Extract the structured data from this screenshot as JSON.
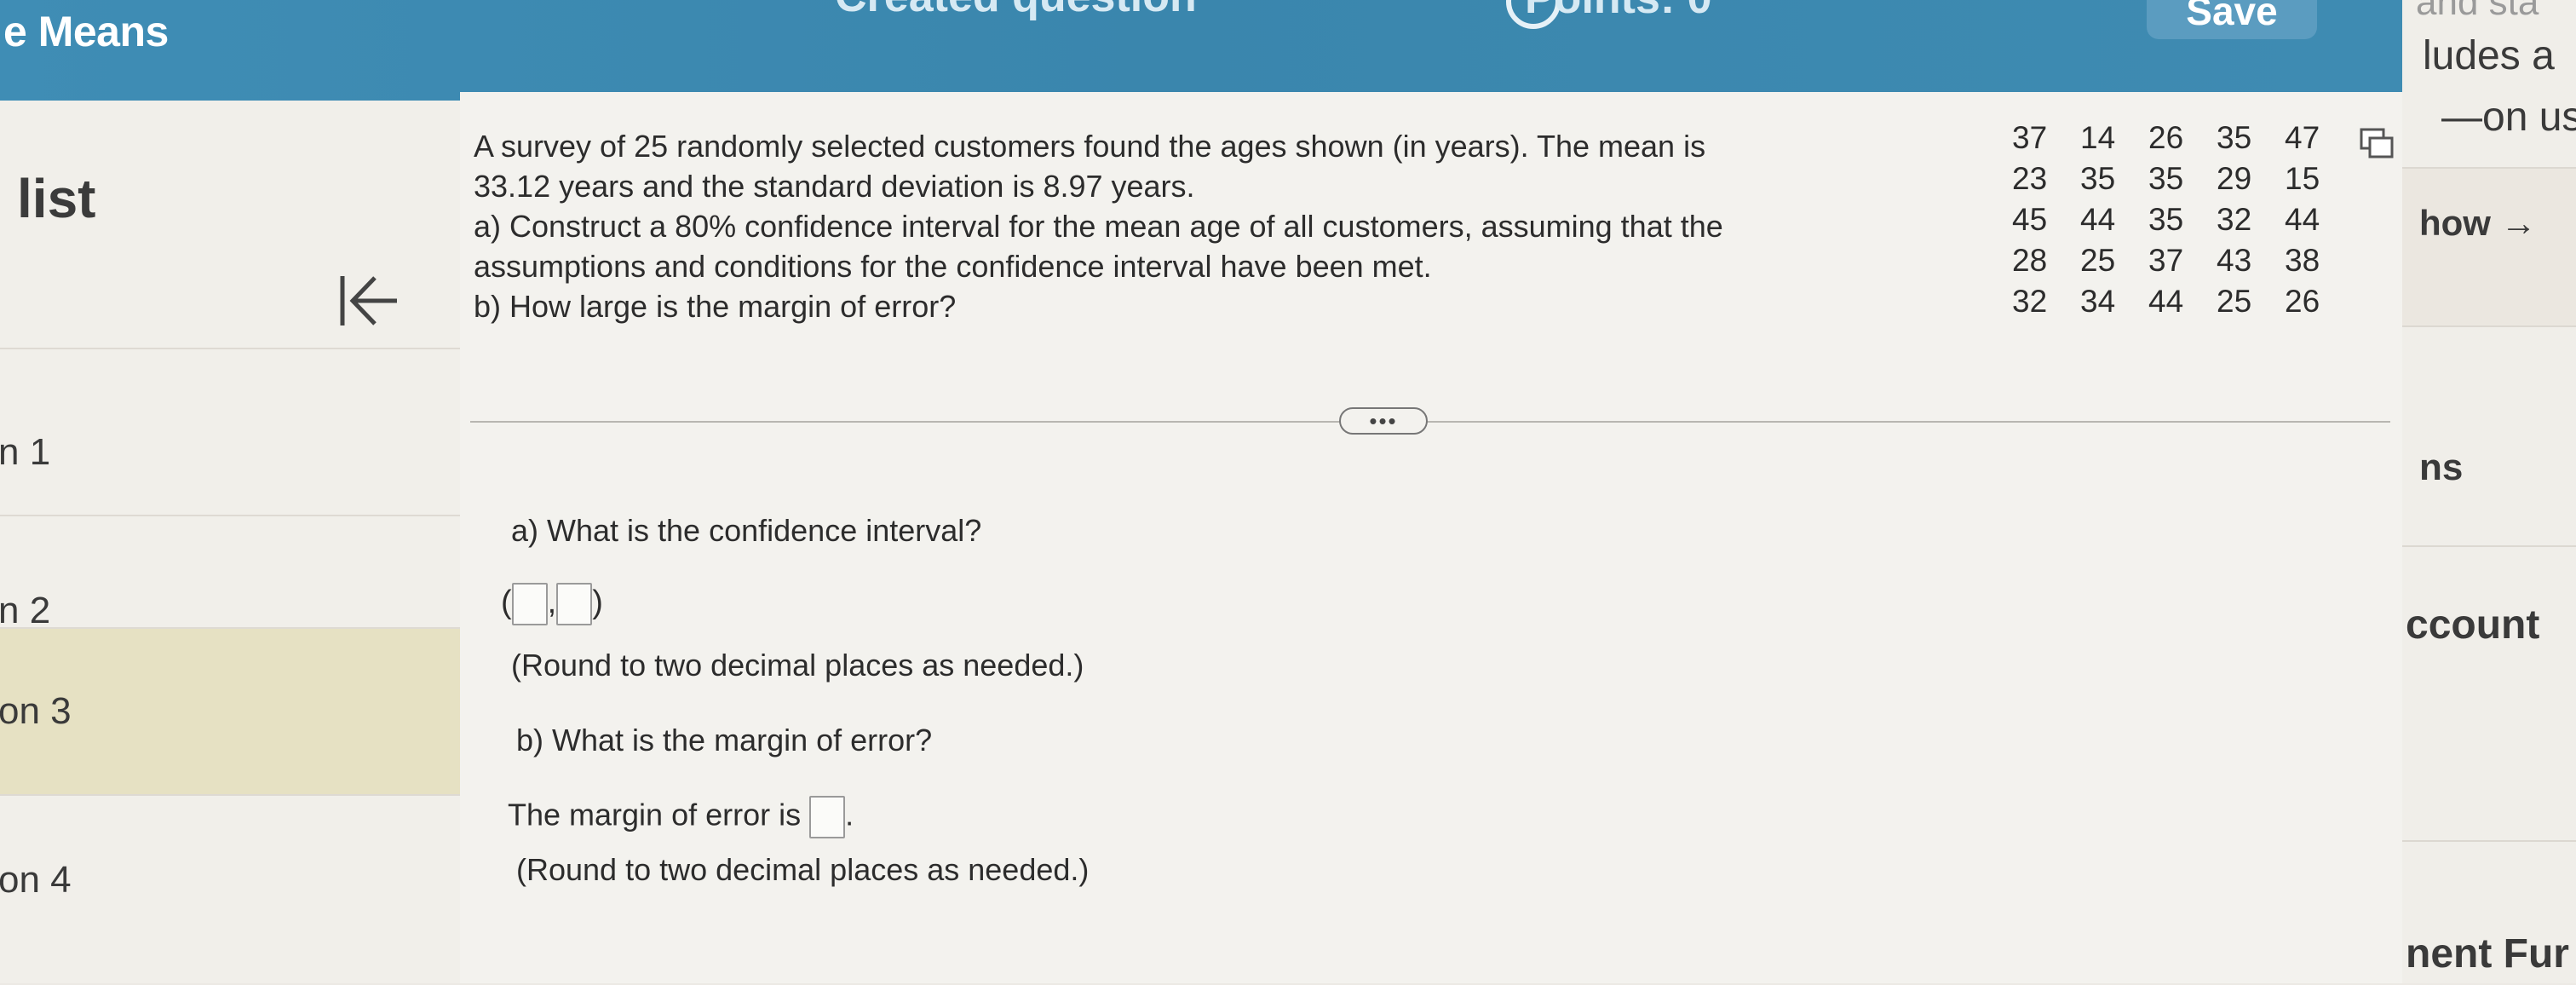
{
  "header": {
    "title": "e Means",
    "cut_text_1": "Created question",
    "cut_text_2": "Points: 0",
    "save_label": "Save"
  },
  "sidebar": {
    "title": "list",
    "items": [
      {
        "label": "n 1"
      },
      {
        "label": "n 2"
      },
      {
        "label": "on 3",
        "active": true
      },
      {
        "label": "on 4"
      }
    ]
  },
  "question": {
    "text_lines": [
      "A survey of 25 randomly selected customers found the ages shown (in years). The mean is",
      "33.12 years and the standard deviation is 8.97 years.",
      "a) Construct a 80% confidence interval for the mean age of all customers, assuming that the",
      "assumptions and conditions for the confidence interval have been met.",
      "b) How large is the margin of error?"
    ],
    "data_rows": [
      [
        "37",
        "14",
        "26",
        "35",
        "47"
      ],
      [
        "23",
        "35",
        "35",
        "29",
        "15"
      ],
      [
        "45",
        "44",
        "35",
        "32",
        "44"
      ],
      [
        "28",
        "25",
        "37",
        "43",
        "38"
      ],
      [
        "32",
        "34",
        "44",
        "25",
        "26"
      ]
    ],
    "more_label": "•••"
  },
  "answer": {
    "part_a_prompt": "a) What is the confidence interval?",
    "interval_open": "(",
    "interval_comma": ",",
    "interval_close": ")",
    "round_note_a": "(Round to two decimal places as needed.)",
    "part_b_prompt": "b) What is the margin of error?",
    "moe_prefix": "The margin of error is",
    "moe_suffix": ".",
    "round_note_b": "(Round to two decimal places as needed.)"
  },
  "rightbar": {
    "cut_top": "and sta",
    "ludes": "ludes a",
    "on_us": "—on us",
    "how": "how →",
    "ns": "ns",
    "account": "ccount",
    "fund": "nent Fur"
  },
  "colors": {
    "header": "#3f8db5",
    "active_item": "#e6e1c3",
    "background": "#f3f2ee"
  }
}
